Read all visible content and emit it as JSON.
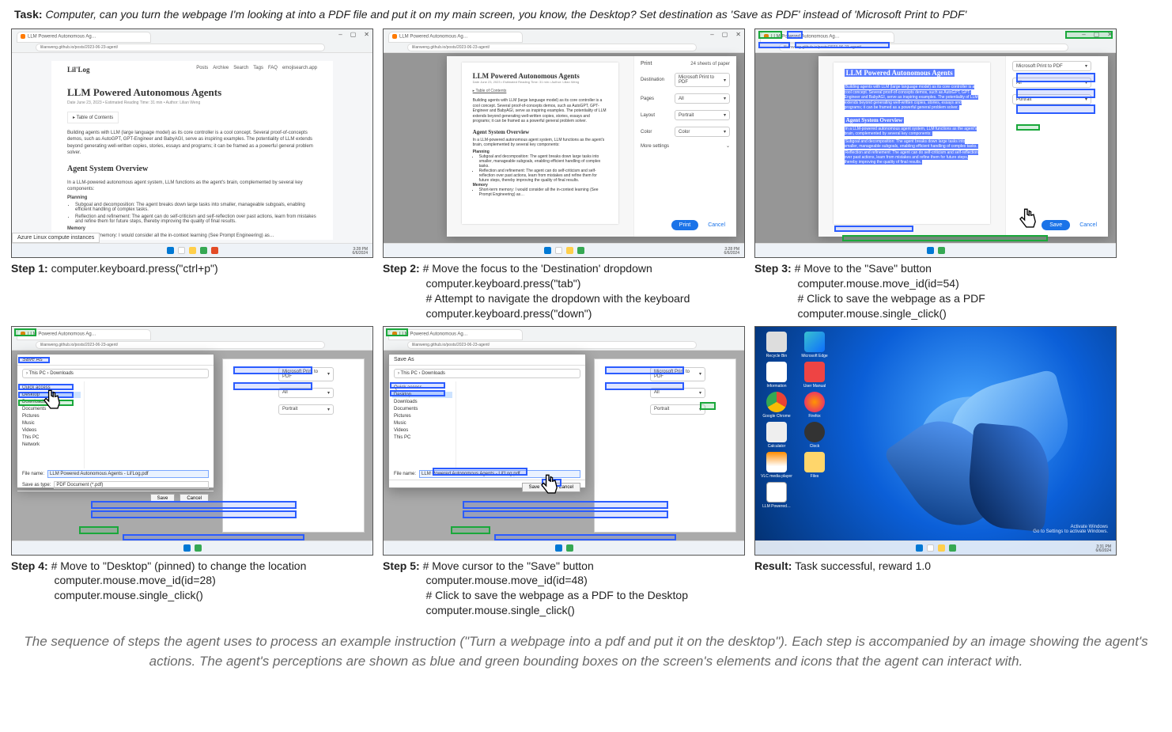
{
  "task": {
    "label": "Task:",
    "text": "Computer, can you turn the webpage I'm looking at into a PDF file and put it on my main screen, you know, the Desktop? Set destination as 'Save as PDF' instead of 'Microsoft Print to PDF'"
  },
  "common": {
    "tab_title": "LLM Powered Autonomous Ag…",
    "url": "lilianweng.github.io/posts/2023-06-23-agent/",
    "window_controls": [
      "–",
      "▢",
      "✕"
    ],
    "taskbar_time": "3:28 PM",
    "taskbar_date": "6/6/2024"
  },
  "page": {
    "site": "Lil'Log",
    "nav": [
      "Posts",
      "Archive",
      "Search",
      "Tags",
      "FAQ",
      "emojisearch.app"
    ],
    "title": "LLM Powered Autonomous Agents",
    "meta": "Date June 23, 2023 • Estimated Reading Time: 31 min • Author: Lilian Weng",
    "toc": "▸ Table of Contents",
    "para1": "Building agents with LLM (large language model) as its core controller is a cool concept. Several proof-of-concepts demos, such as AutoGPT, GPT-Engineer and BabyAGI, serve as inspiring examples. The potentiality of LLM extends beyond generating well-written copies, stories, essays and programs; it can be framed as a powerful general problem solver.",
    "h2a": "Agent System Overview",
    "para2": "In a LLM-powered autonomous agent system, LLM functions as the agent's brain, complemented by several key components:",
    "planning_label": "Planning",
    "bul1": "Subgoal and decomposition: The agent breaks down large tasks into smaller, manageable subgoals, enabling efficient handling of complex tasks.",
    "bul2": "Reflection and refinement: The agent can do self-criticism and self-reflection over past actions, learn from mistakes and refine them for future steps, thereby improving the quality of final results.",
    "memory_label": "Memory",
    "bul3": "Short-term memory: I would consider all the in-context learning (See Prompt Engineering) as…",
    "status_hover": "Azure Linux compute instances"
  },
  "print_dialog": {
    "header": "Print",
    "sheets": "24 sheets of paper",
    "rows": {
      "destination": "Destination",
      "destination_value": "Microsoft Print to PDF",
      "pages": "Pages",
      "pages_value": "All",
      "layout": "Layout",
      "layout_value": "Portrait",
      "color": "Color",
      "color_value": "Color",
      "more": "More settings"
    },
    "save": "Print",
    "save_btn_step3": "Save",
    "cancel": "Cancel"
  },
  "saveas": {
    "title": "Save As",
    "path": "› This PC › Downloads",
    "tree": [
      "Quick access",
      "Desktop",
      "Downloads",
      "Documents",
      "Pictures",
      "Music",
      "Videos",
      "This PC",
      "Network"
    ],
    "filename_label": "File name:",
    "filename": "LLM Powered Autonomous Agents - Lil'Log.pdf",
    "type_label": "Save as type:",
    "type": "PDF Document (*.pdf)",
    "save": "Save",
    "cancel": "Cancel"
  },
  "desktop": {
    "icons": [
      "Recycle Bin",
      "Microsoft Edge",
      "Information",
      "User Manual",
      "Google Chrome",
      "Firefox",
      "Calculator",
      "Clock",
      "VLC media player",
      "Files",
      "LLM Powered…"
    ],
    "activation": "Activate Windows\nGo to Settings to activate Windows.",
    "taskbar_time": "3:31 PM",
    "taskbar_date": "6/6/2024"
  },
  "steps": {
    "s1": {
      "label": "Step 1:",
      "l1": "computer.keyboard.press(\"ctrl+p\")"
    },
    "s2": {
      "label": "Step 2:",
      "l1": "# Move the focus to the 'Destination' dropdown",
      "l2": "computer.keyboard.press(\"tab\")",
      "l3": "# Attempt to navigate the dropdown with the keyboard",
      "l4": "computer.keyboard.press(\"down\")"
    },
    "s3": {
      "label": "Step 3:",
      "l1": "# Move to the \"Save\" button",
      "l2": "computer.mouse.move_id(id=54)",
      "l3": "# Click to save the webpage as a PDF",
      "l4": "computer.mouse.single_click()"
    },
    "s4": {
      "label": "Step 4:",
      "l1": "# Move to \"Desktop\" (pinned) to change the location",
      "l2": "computer.mouse.move_id(id=28)",
      "l3": "computer.mouse.single_click()"
    },
    "s5": {
      "label": "Step 5:",
      "l1": "# Move cursor to the \"Save\" button",
      "l2": "computer.mouse.move_id(id=48)",
      "l3": "# Click to save the webpage as a PDF to the Desktop",
      "l4": "computer.mouse.single_click()"
    },
    "result": {
      "label": "Result:",
      "l1": "Task successful, reward 1.0"
    }
  },
  "footer": "The sequence of steps the agent uses to process an example instruction (\"Turn a webpage into a pdf and put it on the desktop\"). Each step is accompanied by an image showing the agent's actions. The agent's perceptions are shown as blue and green bounding boxes on the screen's elements and icons that the agent can interact with."
}
